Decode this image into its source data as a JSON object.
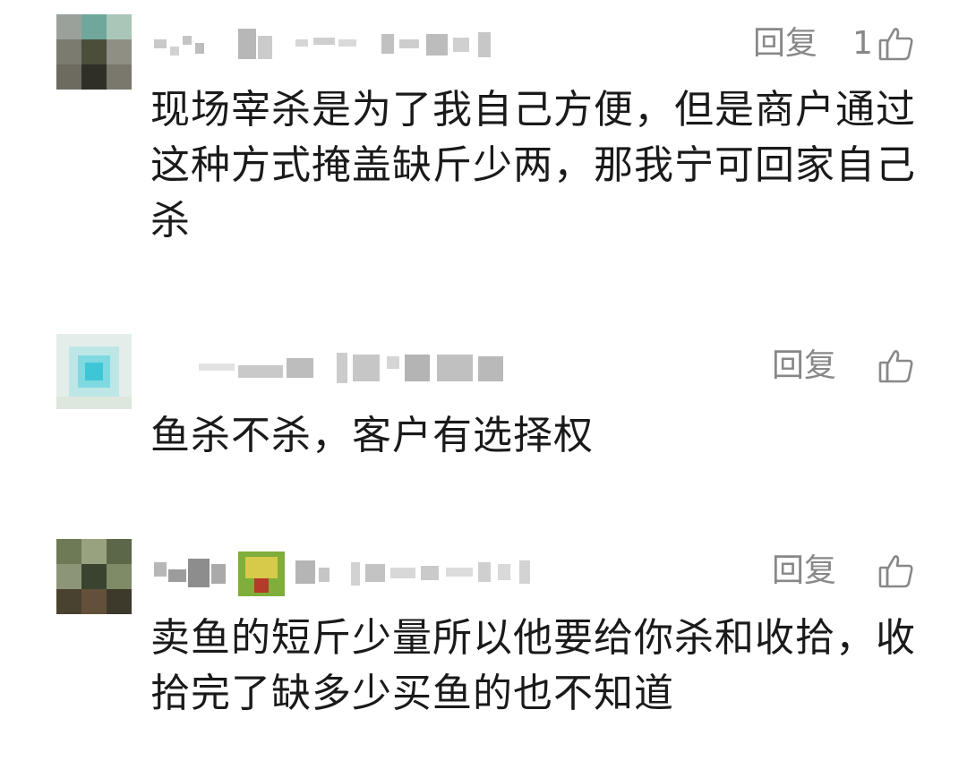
{
  "comments": [
    {
      "reply_label": "回复",
      "like_count": "1",
      "text": "现场宰杀是为了我自己方便，但是商户通过这种方式掩盖缺斤少两，那我宁可回家自己杀",
      "avatar_color": "#5f6b4a"
    },
    {
      "reply_label": "回复",
      "like_count": "",
      "text": "鱼杀不杀，客户有选择权",
      "avatar_color": "#7fd9e0"
    },
    {
      "reply_label": "回复",
      "like_count": "",
      "text": "卖鱼的短斤少量所以他要给你杀和收拾，收拾完了缺多少买鱼的也不知道",
      "avatar_color": "#3d4a2e"
    }
  ],
  "colors": {
    "secondary_text": "#888888",
    "primary_text": "#1a1a1a",
    "background": "#ffffff"
  },
  "icons": {
    "like": "thumbs-up-icon"
  }
}
